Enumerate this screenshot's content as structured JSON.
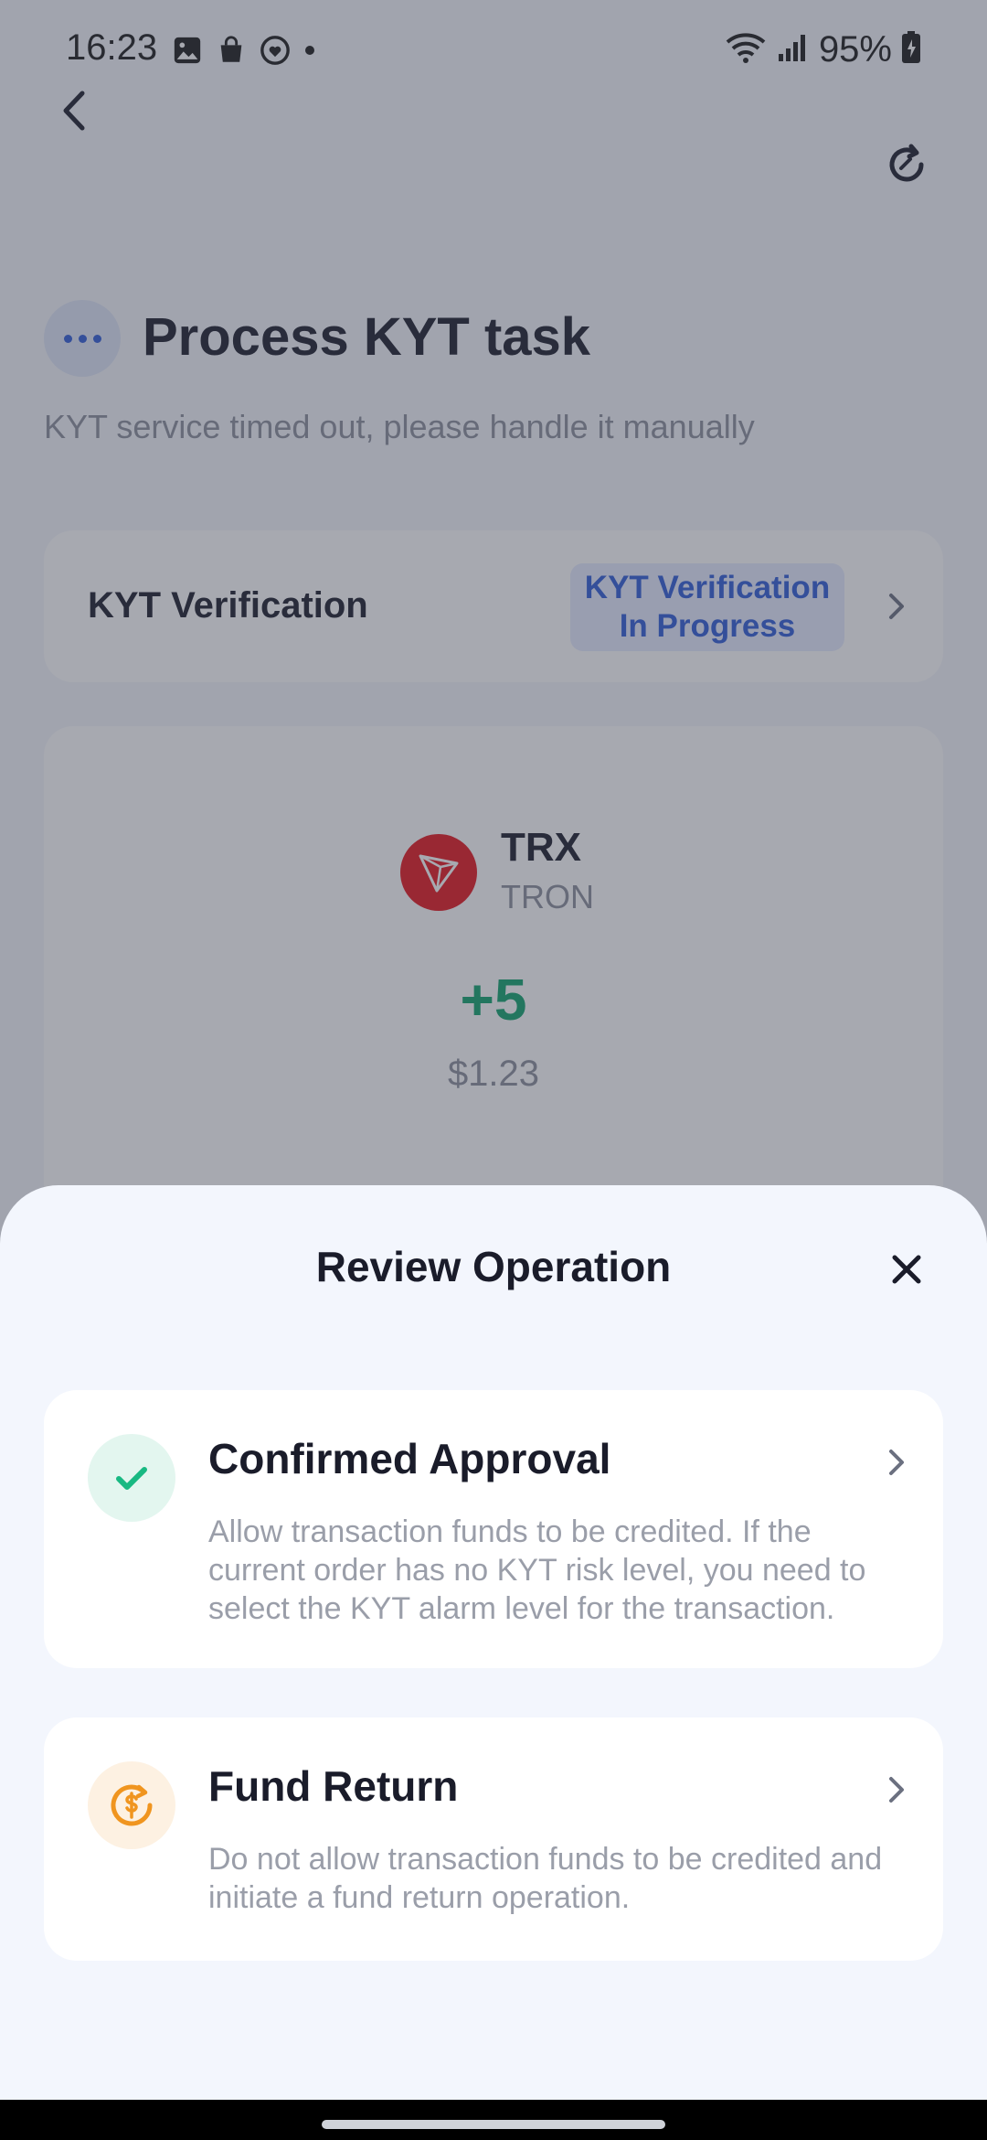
{
  "status_bar": {
    "time": "16:23",
    "battery": "95%",
    "icons_left": [
      "gallery-icon",
      "shopping-bag-icon",
      "heart-sync-icon",
      "dot-icon"
    ],
    "icons_right": [
      "wifi-icon",
      "signal-icon",
      "battery-icon"
    ]
  },
  "header": {
    "title": "Process KYT task",
    "subtitle": "KYT service timed out, please handle it manually"
  },
  "kyt": {
    "label": "KYT Verification",
    "status": "KYT Verification In Progress"
  },
  "transaction": {
    "symbol": "TRX",
    "network": "TRON",
    "amount": "+5",
    "fiat": "$1.23"
  },
  "sheet": {
    "title": "Review Operation",
    "options": [
      {
        "title": "Confirmed Approval",
        "description": "Allow transaction funds to be credited. If the current order has no KYT risk level, you need to select the KYT alarm level for the transaction."
      },
      {
        "title": "Fund Return",
        "description": "Do not allow transaction funds to be credited and initiate a fund return operation."
      }
    ]
  },
  "colors": {
    "accent_blue": "#2f5bd8",
    "positive_green": "#0fa36c",
    "trx_red": "#e5141d",
    "return_orange": "#f0951f"
  }
}
